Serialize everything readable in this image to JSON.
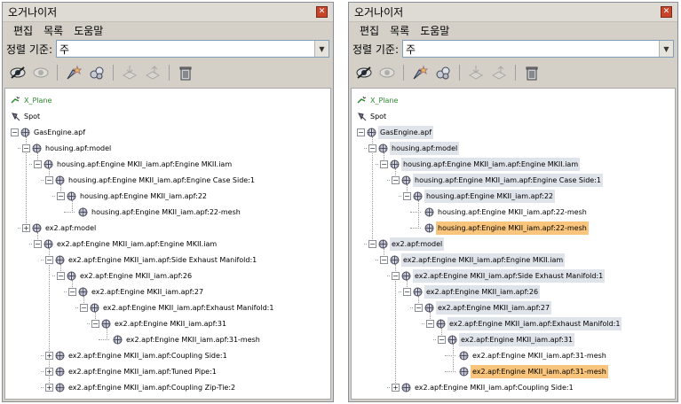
{
  "title": "오거나이저",
  "menu": [
    "편집",
    "목록",
    "도움말"
  ],
  "sort": {
    "label": "정렬 기준:",
    "value": "주"
  },
  "toolbar_icons": [
    "hide-icon",
    "show-icon",
    "highlight-icon",
    "group-icon",
    "import-icon",
    "export-icon",
    "delete-icon"
  ],
  "colors": {
    "selected": "#f9c57c",
    "highlight": "#dfe3ea"
  },
  "left_tree": [
    {
      "label": "X_Plane",
      "level": 0,
      "icon": "plane",
      "exp": "none",
      "style": "green"
    },
    {
      "label": "Spot",
      "level": 0,
      "icon": "spot",
      "exp": "none",
      "style": ""
    },
    {
      "label": "GasEngine.apf",
      "level": 0,
      "icon": "grid",
      "exp": "-",
      "style": ""
    },
    {
      "label": "housing.apf:model",
      "level": 1,
      "icon": "grid",
      "exp": "-",
      "style": ""
    },
    {
      "label": "housing.apf:Engine MKII_iam.apf:Engine MKII.iam",
      "level": 2,
      "icon": "grid",
      "exp": "-",
      "style": ""
    },
    {
      "label": "housing.apf:Engine MKII_iam.apf:Engine Case Side:1",
      "level": 3,
      "icon": "grid",
      "exp": "-",
      "style": ""
    },
    {
      "label": "housing.apf:Engine MKII_iam.apf:22",
      "level": 4,
      "icon": "grid",
      "exp": "-",
      "style": ""
    },
    {
      "label": "housing.apf:Engine MKII_iam.apf:22-mesh",
      "level": 5,
      "icon": "grid",
      "exp": "none",
      "style": ""
    },
    {
      "label": "ex2.apf:model",
      "level": 1,
      "icon": "grid",
      "exp": "+",
      "style": ""
    },
    {
      "label": "ex2.apf:Engine MKII_iam.apf:Engine MKII.iam",
      "level": 2,
      "icon": "grid",
      "exp": "-",
      "style": ""
    },
    {
      "label": "ex2.apf:Engine MKII_iam.apf:Side Exhaust Manifold:1",
      "level": 3,
      "icon": "grid",
      "exp": "-",
      "style": ""
    },
    {
      "label": "ex2.apf:Engine MKII_iam.apf:26",
      "level": 4,
      "icon": "grid",
      "exp": "-",
      "style": ""
    },
    {
      "label": "ex2.apf:Engine MKII_iam.apf:27",
      "level": 5,
      "icon": "grid",
      "exp": "-",
      "style": ""
    },
    {
      "label": "ex2.apf:Engine MKII_iam.apf:Exhaust Manifold:1",
      "level": 6,
      "icon": "grid",
      "exp": "-",
      "style": ""
    },
    {
      "label": "ex2.apf:Engine MKII_iam.apf:31",
      "level": 7,
      "icon": "grid",
      "exp": "-",
      "style": ""
    },
    {
      "label": "ex2.apf:Engine MKII_iam.apf:31-mesh",
      "level": 8,
      "icon": "grid",
      "exp": "none",
      "style": ""
    },
    {
      "label": "ex2.apf:Engine MKII_iam.apf:Coupling Side:1",
      "level": 3,
      "icon": "grid",
      "exp": "+",
      "style": ""
    },
    {
      "label": "ex2.apf:Engine MKII_iam.apf:Tuned Pipe:1",
      "level": 3,
      "icon": "grid",
      "exp": "+",
      "style": ""
    },
    {
      "label": "ex2.apf:Engine MKII_iam.apf:Coupling Zip-Tie:2",
      "level": 3,
      "icon": "grid",
      "exp": "+",
      "style": ""
    }
  ],
  "right_tree": [
    {
      "label": "X_Plane",
      "level": 0,
      "icon": "plane",
      "exp": "none",
      "style": "green"
    },
    {
      "label": "Spot",
      "level": 0,
      "icon": "spot",
      "exp": "none",
      "style": ""
    },
    {
      "label": "GasEngine.apf",
      "level": 0,
      "icon": "grid",
      "exp": "-",
      "style": "hl"
    },
    {
      "label": "housing.apf:model",
      "level": 1,
      "icon": "grid",
      "exp": "-",
      "style": "hl"
    },
    {
      "label": "housing.apf:Engine MKII_iam.apf:Engine MKII.iam",
      "level": 2,
      "icon": "grid",
      "exp": "-",
      "style": "hl"
    },
    {
      "label": "housing.apf:Engine MKII_iam.apf:Engine Case Side:1",
      "level": 3,
      "icon": "grid",
      "exp": "-",
      "style": "hl"
    },
    {
      "label": "housing.apf:Engine MKII_iam.apf:22",
      "level": 4,
      "icon": "grid",
      "exp": "-",
      "style": "hl"
    },
    {
      "label": "housing.apf:Engine MKII_iam.apf:22-mesh",
      "level": 5,
      "icon": "grid",
      "exp": "none",
      "style": ""
    },
    {
      "label": "housing.apf:Engine MKII_iam.apf:22-mesh",
      "level": 5,
      "icon": "grid",
      "exp": "none",
      "style": "sel"
    },
    {
      "label": "ex2.apf:model",
      "level": 1,
      "icon": "grid",
      "exp": "-",
      "style": "hl"
    },
    {
      "label": "ex2.apf:Engine MKII_iam.apf:Engine MKII.iam",
      "level": 2,
      "icon": "grid",
      "exp": "-",
      "style": "hl"
    },
    {
      "label": "ex2.apf:Engine MKII_iam.apf:Side Exhaust Manifold:1",
      "level": 3,
      "icon": "grid",
      "exp": "-",
      "style": "hl"
    },
    {
      "label": "ex2.apf:Engine MKII_iam.apf:26",
      "level": 4,
      "icon": "grid",
      "exp": "-",
      "style": "hl"
    },
    {
      "label": "ex2.apf:Engine MKII_iam.apf:27",
      "level": 5,
      "icon": "grid",
      "exp": "-",
      "style": "hl"
    },
    {
      "label": "ex2.apf:Engine MKII_iam.apf:Exhaust Manifold:1",
      "level": 6,
      "icon": "grid",
      "exp": "-",
      "style": "hl"
    },
    {
      "label": "ex2.apf:Engine MKII_iam.apf:31",
      "level": 7,
      "icon": "grid",
      "exp": "-",
      "style": "hl"
    },
    {
      "label": "ex2.apf:Engine MKII_iam.apf:31-mesh",
      "level": 8,
      "icon": "grid",
      "exp": "none",
      "style": ""
    },
    {
      "label": "ex2.apf:Engine MKII_iam.apf:31-mesh",
      "level": 8,
      "icon": "grid",
      "exp": "none",
      "style": "sel"
    },
    {
      "label": "ex2.apf:Engine MKII_iam.apf:Coupling Side:1",
      "level": 3,
      "icon": "grid",
      "exp": "+",
      "style": ""
    }
  ]
}
